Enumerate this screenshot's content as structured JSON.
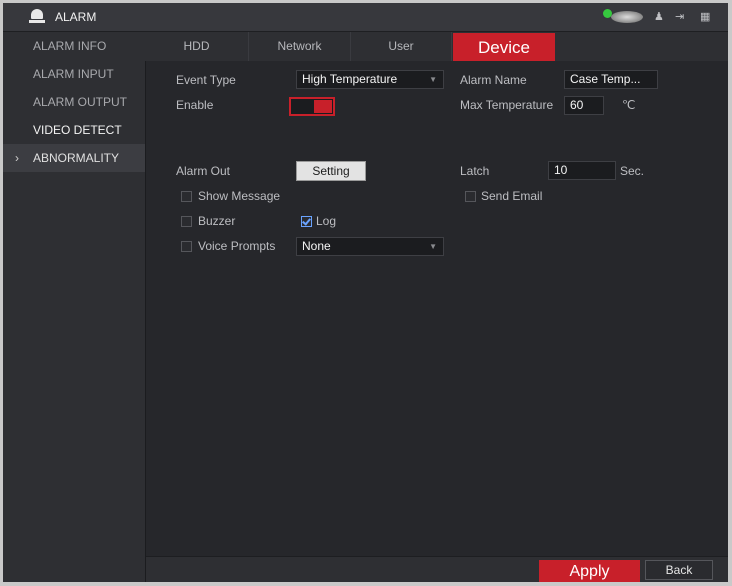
{
  "titlebar": {
    "title": "ALARM",
    "icons": [
      "alarm-lamp-icon",
      "hdd-status-icon",
      "user-icon",
      "logout-icon",
      "menu-grid-icon"
    ],
    "status_dot_color": "#36c93f",
    "user_glyph": "♟",
    "logout_glyph": "⇥",
    "grid_glyph": "▦"
  },
  "sidebar": {
    "items": [
      {
        "label": "ALARM INFO"
      },
      {
        "label": "ALARM INPUT"
      },
      {
        "label": "ALARM OUTPUT"
      },
      {
        "label": "VIDEO DETECT"
      },
      {
        "label": "ABNORMALITY",
        "chevron": "›"
      }
    ]
  },
  "tabs": [
    {
      "label": "HDD"
    },
    {
      "label": "Network"
    },
    {
      "label": "User"
    },
    {
      "label": "Device"
    }
  ],
  "active_tab": "Device",
  "accent_color": "#c8202a",
  "form": {
    "event_type_label": "Event Type",
    "event_type_value": "High Temperature",
    "alarm_name_label": "Alarm Name",
    "alarm_name_value": "Case Temp...",
    "enable_label": "Enable",
    "enable_on": true,
    "max_temp_label": "Max Temperature",
    "max_temp_value": "60",
    "max_temp_unit": "℃",
    "alarm_out_label": "Alarm Out",
    "setting_label": "Setting",
    "latch_label": "Latch",
    "latch_value": "10",
    "latch_unit": "Sec.",
    "show_message_label": "Show Message",
    "show_message_checked": false,
    "send_email_label": "Send Email",
    "send_email_checked": false,
    "buzzer_label": "Buzzer",
    "buzzer_checked": false,
    "log_label": "Log",
    "log_checked": true,
    "voice_prompts_label": "Voice Prompts",
    "voice_prompts_checked": false,
    "voice_prompts_value": "None",
    "caret_glyph": "▼"
  },
  "footer": {
    "apply_label": "Apply",
    "back_label": "Back"
  }
}
